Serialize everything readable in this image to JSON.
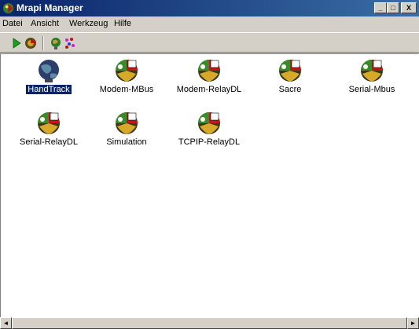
{
  "window": {
    "title": "Mrapi Manager"
  },
  "menu": [
    "Datei",
    "Ansicht",
    "Werkzeug",
    "Hilfe"
  ],
  "caption": {
    "minimize": "_",
    "maximize": "□",
    "close": "X"
  },
  "toolbar": {
    "icons": [
      "play-icon",
      "disk-icon",
      "globe-icon",
      "dots-icon"
    ]
  },
  "items": [
    {
      "label": "HandTrack"
    },
    {
      "label": "Modem-MBus"
    },
    {
      "label": "Modem-RelayDL"
    },
    {
      "label": "Sacre"
    },
    {
      "label": "Serial-Mbus"
    },
    {
      "label": "Serial-RelayDL"
    },
    {
      "label": "Simulation"
    },
    {
      "label": "TCPIP-RelayDL"
    }
  ],
  "scrollbar": {
    "left_arrow": "◄",
    "right_arrow": "►"
  }
}
